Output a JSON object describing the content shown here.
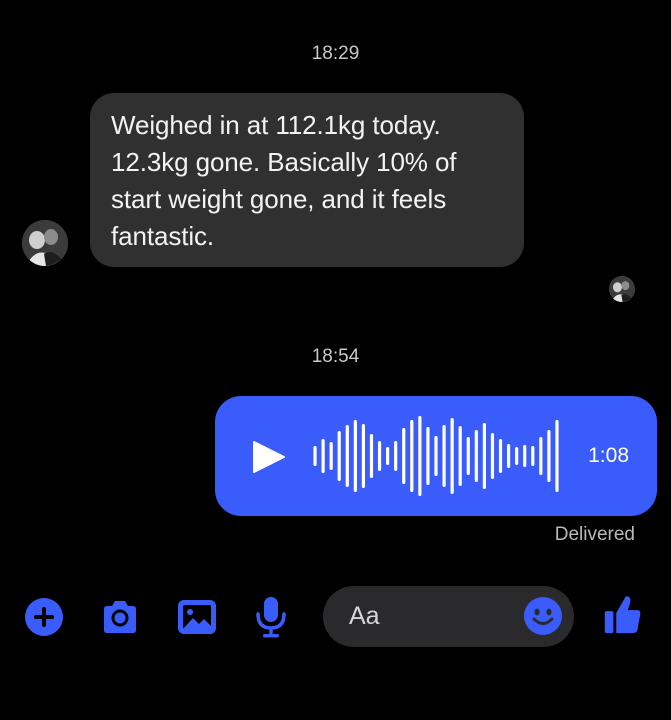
{
  "conversation": {
    "timestamp_1": "18:29",
    "incoming_message": "Weighed in at 112.1kg today. 12.3kg gone. Basically 10% of start weight gone, and it feels fantastic.",
    "timestamp_2": "18:54",
    "voice_message": {
      "duration": "1:08",
      "play_icon": "play-icon"
    },
    "status": "Delivered"
  },
  "composer": {
    "placeholder": "Aa",
    "buttons": [
      "plus-icon",
      "camera-icon",
      "photo-icon",
      "microphone-icon",
      "emoji-icon",
      "thumbs-up-icon"
    ]
  },
  "colors": {
    "background": "#000000",
    "incoming_bubble": "#303030",
    "accent": "#3a5cfb",
    "composer_bg": "#2a2a2c",
    "timestamp_text": "#c8c8cc"
  }
}
